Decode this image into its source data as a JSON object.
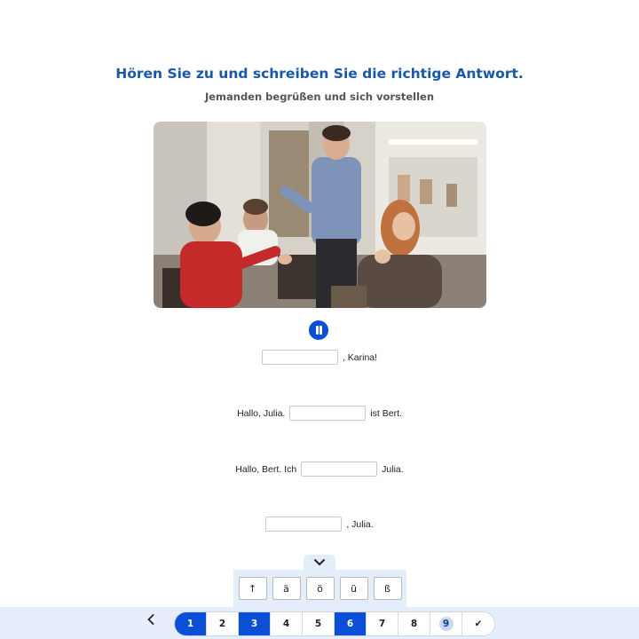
{
  "header": {
    "title": "Hören Sie zu und schreiben Sie die richtige Antwort.",
    "subtitle": "Jemanden begrüßen und sich vorstellen"
  },
  "exercise": {
    "lines": [
      {
        "before": "",
        "after": ", Karina!",
        "value": ""
      },
      {
        "before": "Hallo, Julia.",
        "after": "ist Bert.",
        "value": ""
      },
      {
        "before": "Hallo, Bert. Ich",
        "after": "Julia.",
        "value": ""
      },
      {
        "before": "",
        "after": ", Julia.",
        "value": ""
      }
    ]
  },
  "keyboard": {
    "keys": [
      "↑",
      "ä",
      "ö",
      "ü",
      "ß"
    ]
  },
  "pagination": {
    "pages": [
      {
        "label": "1",
        "state": "done"
      },
      {
        "label": "2",
        "state": "open"
      },
      {
        "label": "3",
        "state": "done"
      },
      {
        "label": "4",
        "state": "open"
      },
      {
        "label": "5",
        "state": "open"
      },
      {
        "label": "6",
        "state": "done"
      },
      {
        "label": "7",
        "state": "open"
      },
      {
        "label": "8",
        "state": "open"
      },
      {
        "label": "9",
        "state": "current"
      },
      {
        "label": "✔",
        "state": "open"
      }
    ]
  },
  "colors": {
    "accent": "#0a4fd6",
    "title": "#1a57a8",
    "bar": "#e6eefb"
  }
}
